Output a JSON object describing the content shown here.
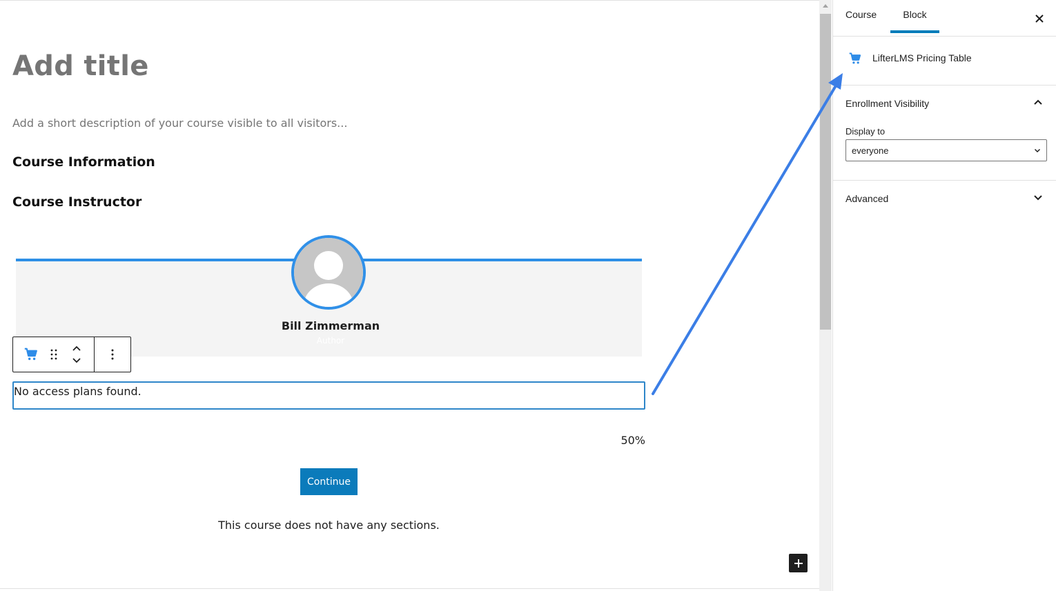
{
  "editor": {
    "title_placeholder": "Add title",
    "description_placeholder": "Add a short description of your course visible to all visitors...",
    "course_information_heading": "Course Information",
    "course_instructor_heading": "Course Instructor",
    "instructor": {
      "name": "Bill Zimmerman",
      "role": "Author"
    },
    "pricing_table_message": "No access plans found.",
    "progress_text": "50%",
    "continue_label": "Continue",
    "no_sections_text": "This course does not have any sections."
  },
  "block_toolbar": {
    "block_icon": "cart-icon",
    "drag_icon": "drag-handle-icon",
    "move_icon": "chevron-up-down-icon",
    "options_icon": "more-vertical-icon"
  },
  "sidebar": {
    "tabs": [
      {
        "label": "Course",
        "active": false
      },
      {
        "label": "Block",
        "active": true
      }
    ],
    "close_icon": "close-icon",
    "block": {
      "icon": "cart-icon",
      "name": "LifterLMS Pricing Table"
    },
    "enrollment_panel": {
      "title": "Enrollment Visibility",
      "expanded": true,
      "field_label": "Display to",
      "selected_value": "everyone"
    },
    "advanced_panel": {
      "title": "Advanced",
      "expanded": false
    }
  },
  "colors": {
    "accent": "#007cba",
    "cart_icon": "#2e8ce8",
    "annotation_arrow": "#3b7ee6",
    "instructor_border": "#2d8fe6",
    "continue_button": "#0b7bbb"
  }
}
